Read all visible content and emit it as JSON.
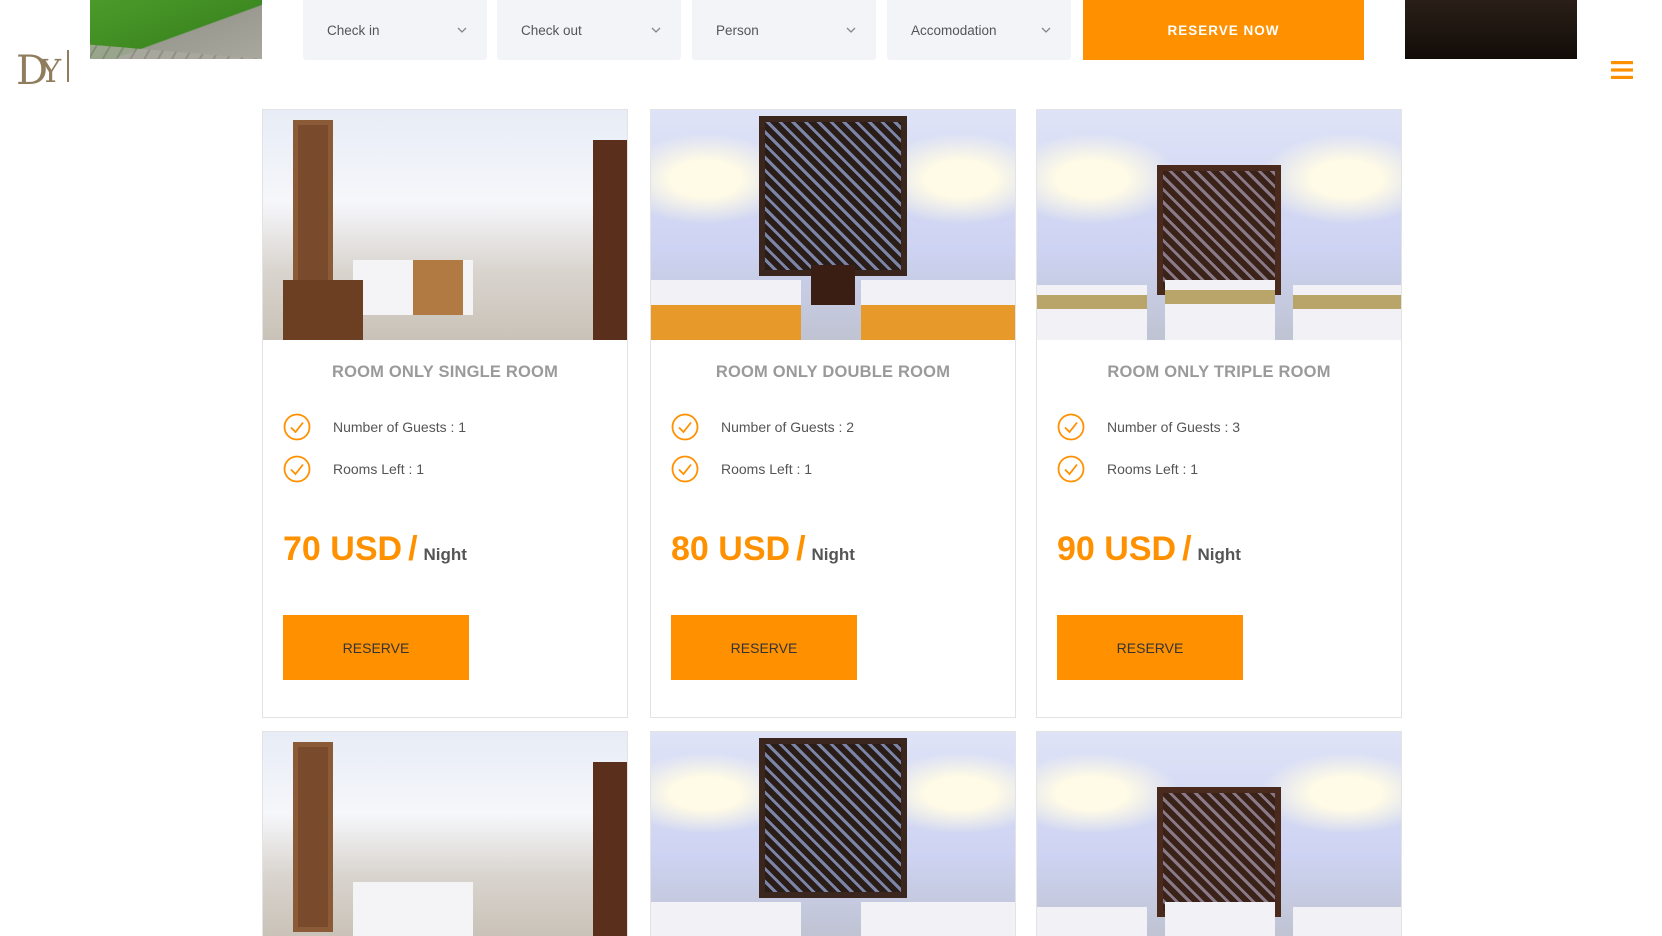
{
  "header": {
    "logo_text": "DYJ",
    "fields": [
      {
        "label": "Check in"
      },
      {
        "label": "Check out"
      },
      {
        "label": "Person"
      },
      {
        "label": "Accomodation"
      }
    ],
    "reserve_now_label": "RESERVE NOW"
  },
  "colors": {
    "accent": "#ff9100",
    "field_bg": "#f3f4f8",
    "title_gray": "#9a9a9a"
  },
  "rooms": [
    {
      "title": "ROOM ONLY SINGLE ROOM",
      "guests": "Number of Guests : 1",
      "rooms_left": "Rooms Left : 1",
      "price": "70 USD",
      "unit": "Night",
      "button": "RESERVE"
    },
    {
      "title": "ROOM ONLY DOUBLE ROOM",
      "guests": "Number of Guests : 2",
      "rooms_left": "Rooms Left : 1",
      "price": "80 USD",
      "unit": "Night",
      "button": "RESERVE"
    },
    {
      "title": "ROOM ONLY TRIPLE ROOM",
      "guests": "Number of Guests : 3",
      "rooms_left": "Rooms Left : 1",
      "price": "90 USD",
      "unit": "Night",
      "button": "RESERVE"
    }
  ],
  "icons": {
    "menu": "hamburger-menu-icon",
    "check": "check-circle-icon",
    "chevron": "chevron-down-icon"
  }
}
